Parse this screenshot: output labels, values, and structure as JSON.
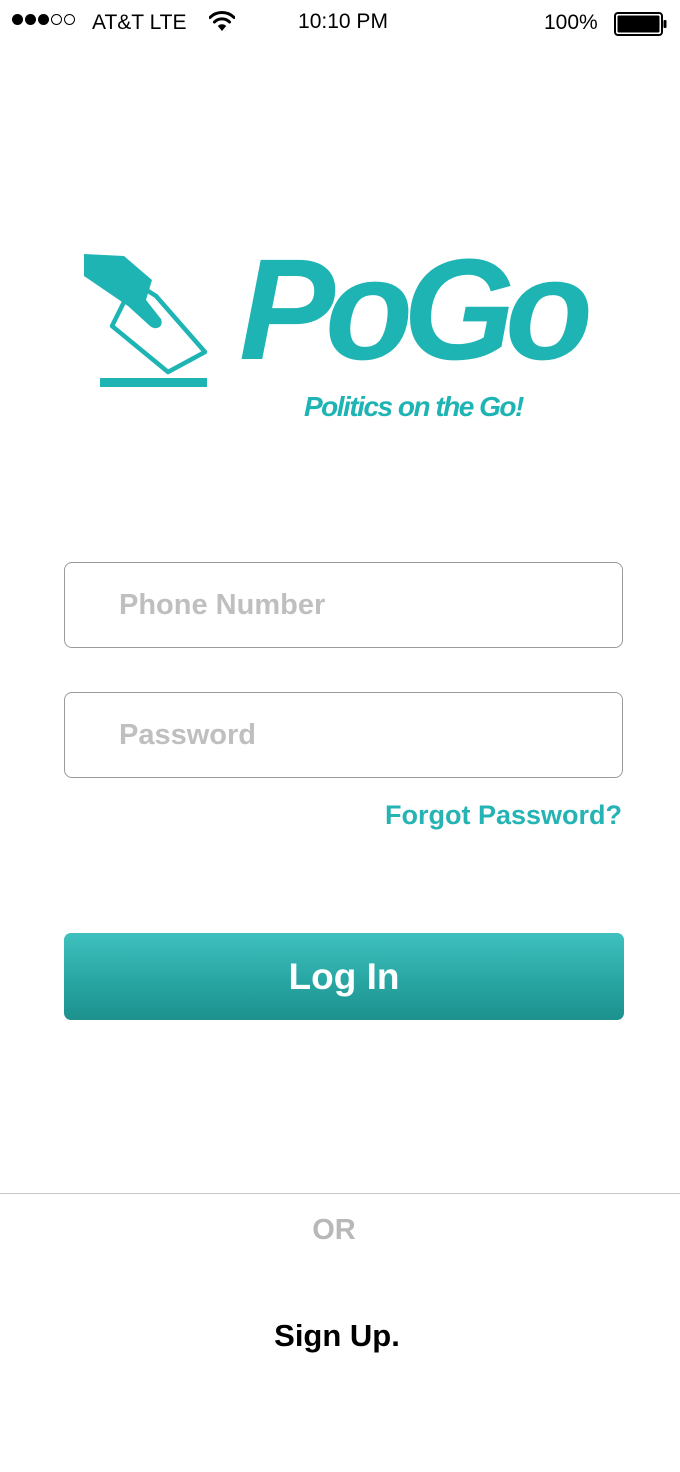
{
  "status_bar": {
    "carrier": "AT&T LTE",
    "time": "10:10 PM",
    "battery": "100%",
    "signal_bars_filled": 3,
    "signal_bars_total": 5,
    "battery_level": 1.0
  },
  "logo": {
    "name": "PoGo",
    "tagline": "Politics on the Go!",
    "icon": "ballot-box-icon"
  },
  "login_form": {
    "phone_placeholder": "Phone Number",
    "password_placeholder": "Password",
    "forgot_password_label": "Forgot Password?",
    "login_label": "Log In"
  },
  "alt_actions": {
    "or_text": "OR",
    "signup_label": "Sign Up."
  },
  "colors": {
    "brand": "#1fb4b4",
    "button_top": "#3fc1bf",
    "button_bottom": "#1d918e",
    "placeholder": "#bfbfbf"
  }
}
